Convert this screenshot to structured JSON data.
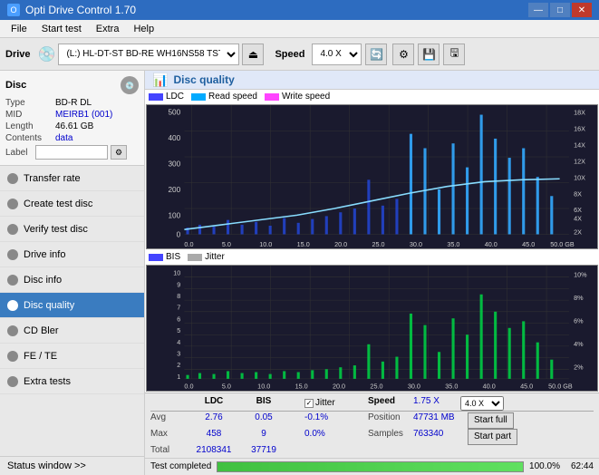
{
  "titlebar": {
    "title": "Opti Drive Control 1.70",
    "minimize": "—",
    "maximize": "□",
    "close": "✕"
  },
  "menu": {
    "items": [
      "File",
      "Start test",
      "Extra",
      "Help"
    ]
  },
  "toolbar": {
    "drive_label": "Drive",
    "drive_value": "(L:) HL-DT-ST BD-RE WH16NS58 TST4",
    "speed_label": "Speed",
    "speed_value": "4.0 X"
  },
  "disc": {
    "title": "Disc",
    "type_label": "Type",
    "type_value": "BD-R DL",
    "mid_label": "MID",
    "mid_value": "MEIRB1 (001)",
    "length_label": "Length",
    "length_value": "46.61 GB",
    "contents_label": "Contents",
    "contents_value": "data",
    "label_label": "Label"
  },
  "nav": {
    "items": [
      {
        "id": "transfer-rate",
        "label": "Transfer rate",
        "active": false
      },
      {
        "id": "create-test-disc",
        "label": "Create test disc",
        "active": false
      },
      {
        "id": "verify-test-disc",
        "label": "Verify test disc",
        "active": false
      },
      {
        "id": "drive-info",
        "label": "Drive info",
        "active": false
      },
      {
        "id": "disc-info",
        "label": "Disc info",
        "active": false
      },
      {
        "id": "disc-quality",
        "label": "Disc quality",
        "active": true
      },
      {
        "id": "cd-bler",
        "label": "CD Bler",
        "active": false
      },
      {
        "id": "fe-te",
        "label": "FE / TE",
        "active": false
      },
      {
        "id": "extra-tests",
        "label": "Extra tests",
        "active": false
      }
    ],
    "status_window": "Status window >>"
  },
  "chart": {
    "title": "Disc quality",
    "legend": {
      "ldc_label": "LDC",
      "read_speed_label": "Read speed",
      "write_speed_label": "Write speed",
      "bis_label": "BIS",
      "jitter_label": "Jitter"
    },
    "top": {
      "y_max": 500,
      "y_labels_left": [
        "500",
        "400",
        "300",
        "200",
        "100",
        "0"
      ],
      "y_labels_right": [
        "18X",
        "16X",
        "14X",
        "12X",
        "10X",
        "8X",
        "6X",
        "4X",
        "2X"
      ],
      "x_labels": [
        "0.0",
        "5.0",
        "10.0",
        "15.0",
        "20.0",
        "25.0",
        "30.0",
        "35.0",
        "40.0",
        "45.0",
        "50.0 GB"
      ]
    },
    "bottom": {
      "y_max": 10,
      "y_labels_left": [
        "10",
        "9",
        "8",
        "7",
        "6",
        "5",
        "4",
        "3",
        "2",
        "1"
      ],
      "y_labels_right": [
        "10%",
        "8%",
        "6%",
        "4%",
        "2%"
      ],
      "x_labels": [
        "0.0",
        "5.0",
        "10.0",
        "15.0",
        "20.0",
        "25.0",
        "30.0",
        "35.0",
        "40.0",
        "45.0",
        "50.0 GB"
      ]
    }
  },
  "stats": {
    "headers": [
      "LDC",
      "BIS",
      "",
      "Jitter",
      "Speed",
      ""
    ],
    "avg_label": "Avg",
    "avg_ldc": "2.76",
    "avg_bis": "0.05",
    "avg_jitter": "-0.1%",
    "max_label": "Max",
    "max_ldc": "458",
    "max_bis": "9",
    "max_jitter": "0.0%",
    "total_label": "Total",
    "total_ldc": "2108341",
    "total_bis": "37719",
    "jitter_checked": true,
    "jitter_check_label": "Jitter",
    "speed_label": "Speed",
    "speed_value": "1.75 X",
    "speed_select": "4.0 X",
    "position_label": "Position",
    "position_value": "47731 MB",
    "samples_label": "Samples",
    "samples_value": "763340",
    "start_full": "Start full",
    "start_part": "Start part"
  },
  "bottom": {
    "status_text": "Test completed",
    "progress": 100,
    "progress_label": "100.0%",
    "time": "62:44"
  }
}
